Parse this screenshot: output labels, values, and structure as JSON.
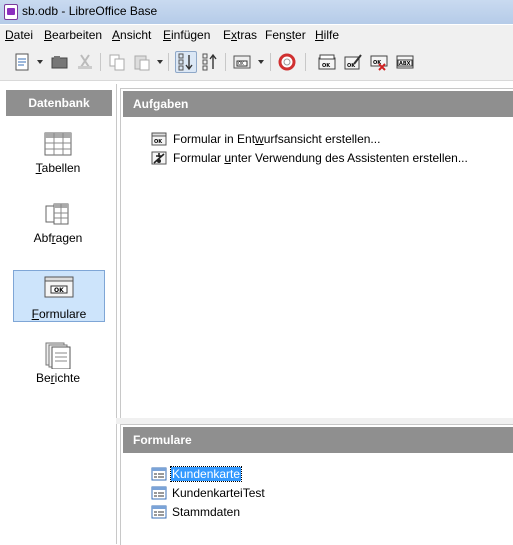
{
  "window": {
    "title": "sb.odb - LibreOffice Base"
  },
  "menu": {
    "items": [
      {
        "pre": "",
        "u": "D",
        "post": "atei"
      },
      {
        "pre": "",
        "u": "B",
        "post": "earbeiten"
      },
      {
        "pre": "",
        "u": "A",
        "post": "nsicht"
      },
      {
        "pre": "",
        "u": "E",
        "post": "infügen"
      },
      {
        "pre": "E",
        "u": "x",
        "post": "tras"
      },
      {
        "pre": "Fen",
        "u": "s",
        "post": "ter"
      },
      {
        "pre": "",
        "u": "H",
        "post": "ilfe"
      }
    ]
  },
  "toolbar": {
    "icons": [
      "new-document-icon",
      "open-icon",
      "print-icon",
      "copy-icon",
      "paste-icon",
      "sort-descending-icon",
      "sort-ascending-icon",
      "form-icon",
      "help-icon",
      "open-db-object-icon",
      "edit-icon",
      "delete-icon",
      "rename-icon"
    ]
  },
  "database_panel": {
    "header": "Datenbank",
    "items": [
      {
        "pre": "",
        "u": "T",
        "post": "abellen",
        "icon": "tables-icon"
      },
      {
        "pre": "Abf",
        "u": "r",
        "post": "agen",
        "icon": "queries-icon"
      },
      {
        "pre": "",
        "u": "F",
        "post": "ormulare",
        "icon": "forms-icon"
      },
      {
        "pre": "Be",
        "u": "r",
        "post": "ichte",
        "icon": "reports-icon"
      }
    ],
    "selected_index": 2
  },
  "tasks_panel": {
    "header": "Aufgaben",
    "tasks": [
      {
        "pre": "Formular in Ent",
        "u": "w",
        "post": "urfsansicht erstellen...",
        "icon": "form-design-icon"
      },
      {
        "pre": "Formular ",
        "u": "u",
        "post": "nter Verwendung des Assistenten erstellen...",
        "icon": "wizard-icon"
      }
    ]
  },
  "forms_panel": {
    "header": "Formulare",
    "forms": [
      {
        "label": "Kundenkarte",
        "selected": true
      },
      {
        "label": "KundenkarteiTest",
        "selected": false
      },
      {
        "label": "Stammdaten",
        "selected": false
      }
    ]
  },
  "colors": {
    "panel_header": "#8f8f8f",
    "selection": "#3399ff",
    "nav_selected_bg": "#cde4fb"
  }
}
